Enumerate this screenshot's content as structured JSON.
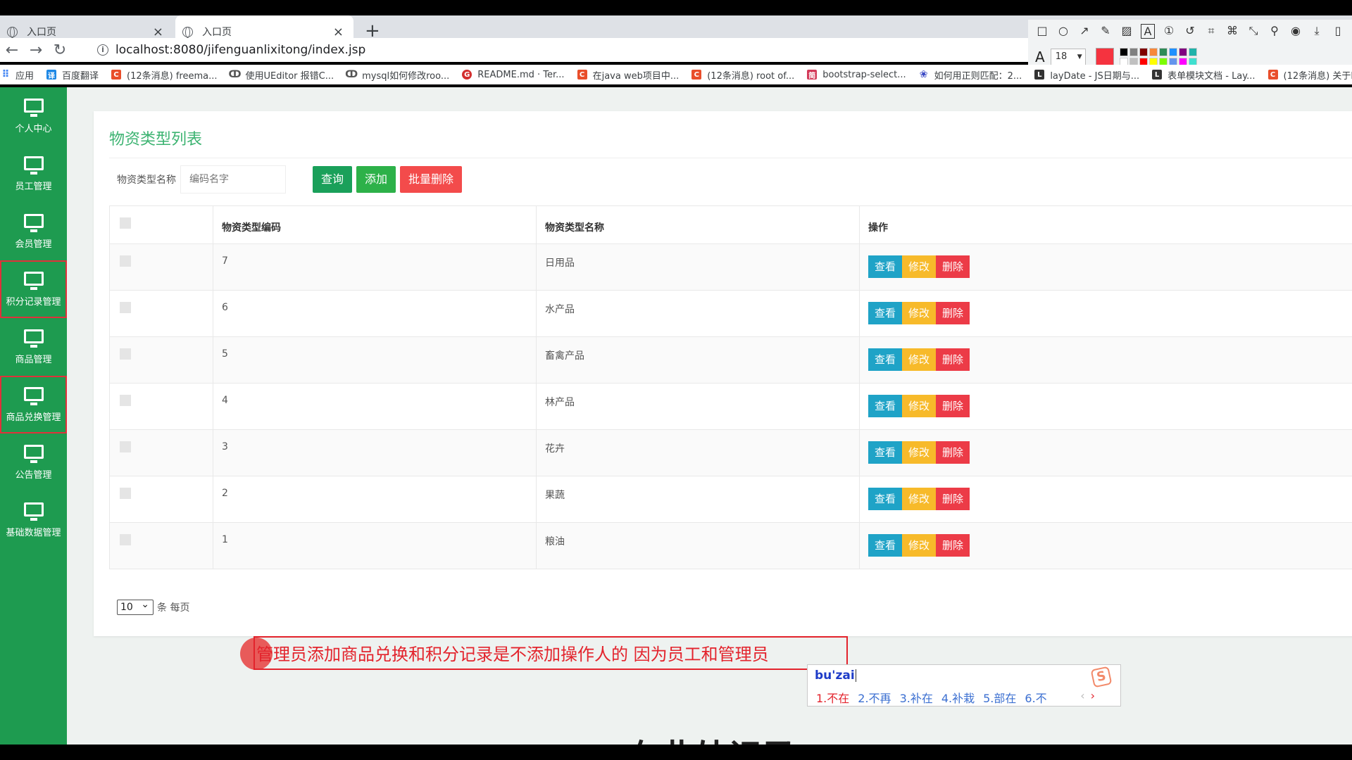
{
  "browser": {
    "tabs": [
      {
        "title": "入口页",
        "active": false
      },
      {
        "title": "入口页",
        "active": true
      }
    ],
    "new_tab": "+",
    "close": "×",
    "url": "localhost:8080/jifenguanlixitong/index.jsp",
    "bookmarks": [
      {
        "label": "应用",
        "icon": "apps-icon"
      },
      {
        "label": "百度翻译",
        "icon": "baidu-translate-icon"
      },
      {
        "label": "(12条消息) freema...",
        "icon": "csdn-icon"
      },
      {
        "label": "使用UEditor 报错C...",
        "icon": "link-icon"
      },
      {
        "label": "mysql如何修改roo...",
        "icon": "link-icon"
      },
      {
        "label": "README.md · Ter...",
        "icon": "gitee-icon"
      },
      {
        "label": "在java web项目中...",
        "icon": "csdn-icon"
      },
      {
        "label": "(12条消息) root of...",
        "icon": "csdn-icon"
      },
      {
        "label": "bootstrap-select...",
        "icon": "site-icon"
      },
      {
        "label": "如何用正则匹配：2...",
        "icon": "baidu-icon"
      },
      {
        "label": "layDate - JS日期与...",
        "icon": "layui-icon"
      },
      {
        "label": "表单模块文档 - Lay...",
        "icon": "layui-icon"
      },
      {
        "label": "(12条消息) 关于lay...",
        "icon": "csdn-icon"
      }
    ]
  },
  "annotation_toolbar": {
    "font_size": "18",
    "current_color": "#f5333f",
    "palette": [
      "#000000",
      "#808080",
      "#800000",
      "#f7883a",
      "#2e8b57",
      "#1e90ff",
      "#800080",
      "#20b2aa",
      "#ffffff",
      "#c0c0c0",
      "#ff0000",
      "#ffff00",
      "#7cfc00",
      "#6495ed",
      "#ff00ff",
      "#40e0d0"
    ]
  },
  "sidebar": {
    "items": [
      {
        "label": "个人中心",
        "highlighted": false
      },
      {
        "label": "员工管理",
        "highlighted": false
      },
      {
        "label": "会员管理",
        "highlighted": false
      },
      {
        "label": "积分记录管理",
        "highlighted": true
      },
      {
        "label": "商品管理",
        "highlighted": false
      },
      {
        "label": "商品兑换管理",
        "highlighted": true
      },
      {
        "label": "公告管理",
        "highlighted": false
      },
      {
        "label": "基础数据管理",
        "highlighted": false
      }
    ]
  },
  "main": {
    "title": "物资类型列表",
    "filter": {
      "label": "物资类型名称",
      "placeholder": "编码名字",
      "query_label": "查询",
      "add_label": "添加",
      "batch_delete_label": "批量删除"
    },
    "table": {
      "headers": {
        "code": "物资类型编码",
        "name": "物资类型名称",
        "ops": "操作"
      },
      "rows": [
        {
          "code": "7",
          "name": "日用品"
        },
        {
          "code": "6",
          "name": "水产品"
        },
        {
          "code": "5",
          "name": "畜禽产品"
        },
        {
          "code": "4",
          "name": "林产品"
        },
        {
          "code": "3",
          "name": "花卉"
        },
        {
          "code": "2",
          "name": "果蔬"
        },
        {
          "code": "1",
          "name": "粮油"
        }
      ],
      "ops": {
        "view": "查看",
        "edit": "修改",
        "delete": "删除"
      }
    },
    "pager": {
      "page_size": "10",
      "suffix": "条 每页"
    }
  },
  "overlay": {
    "annotation_text": "管理员添加商品兑换和积分记录是不添加操作人的 因为员工和管理员",
    "ime": {
      "composition": "bu'zai",
      "candidates": [
        "1.不在",
        "2.不再",
        "3.补在",
        "4.补栽",
        "5.部在",
        "6.不"
      ],
      "logo": "S"
    },
    "bottom_text": "在此处记录..."
  },
  "colors": {
    "sidebar": "#1e9b50",
    "title": "#3cb371",
    "view": "#1fa3c7",
    "edit": "#f7ba2a",
    "delete": "#ec3b47",
    "annotation": "#e3232c"
  }
}
